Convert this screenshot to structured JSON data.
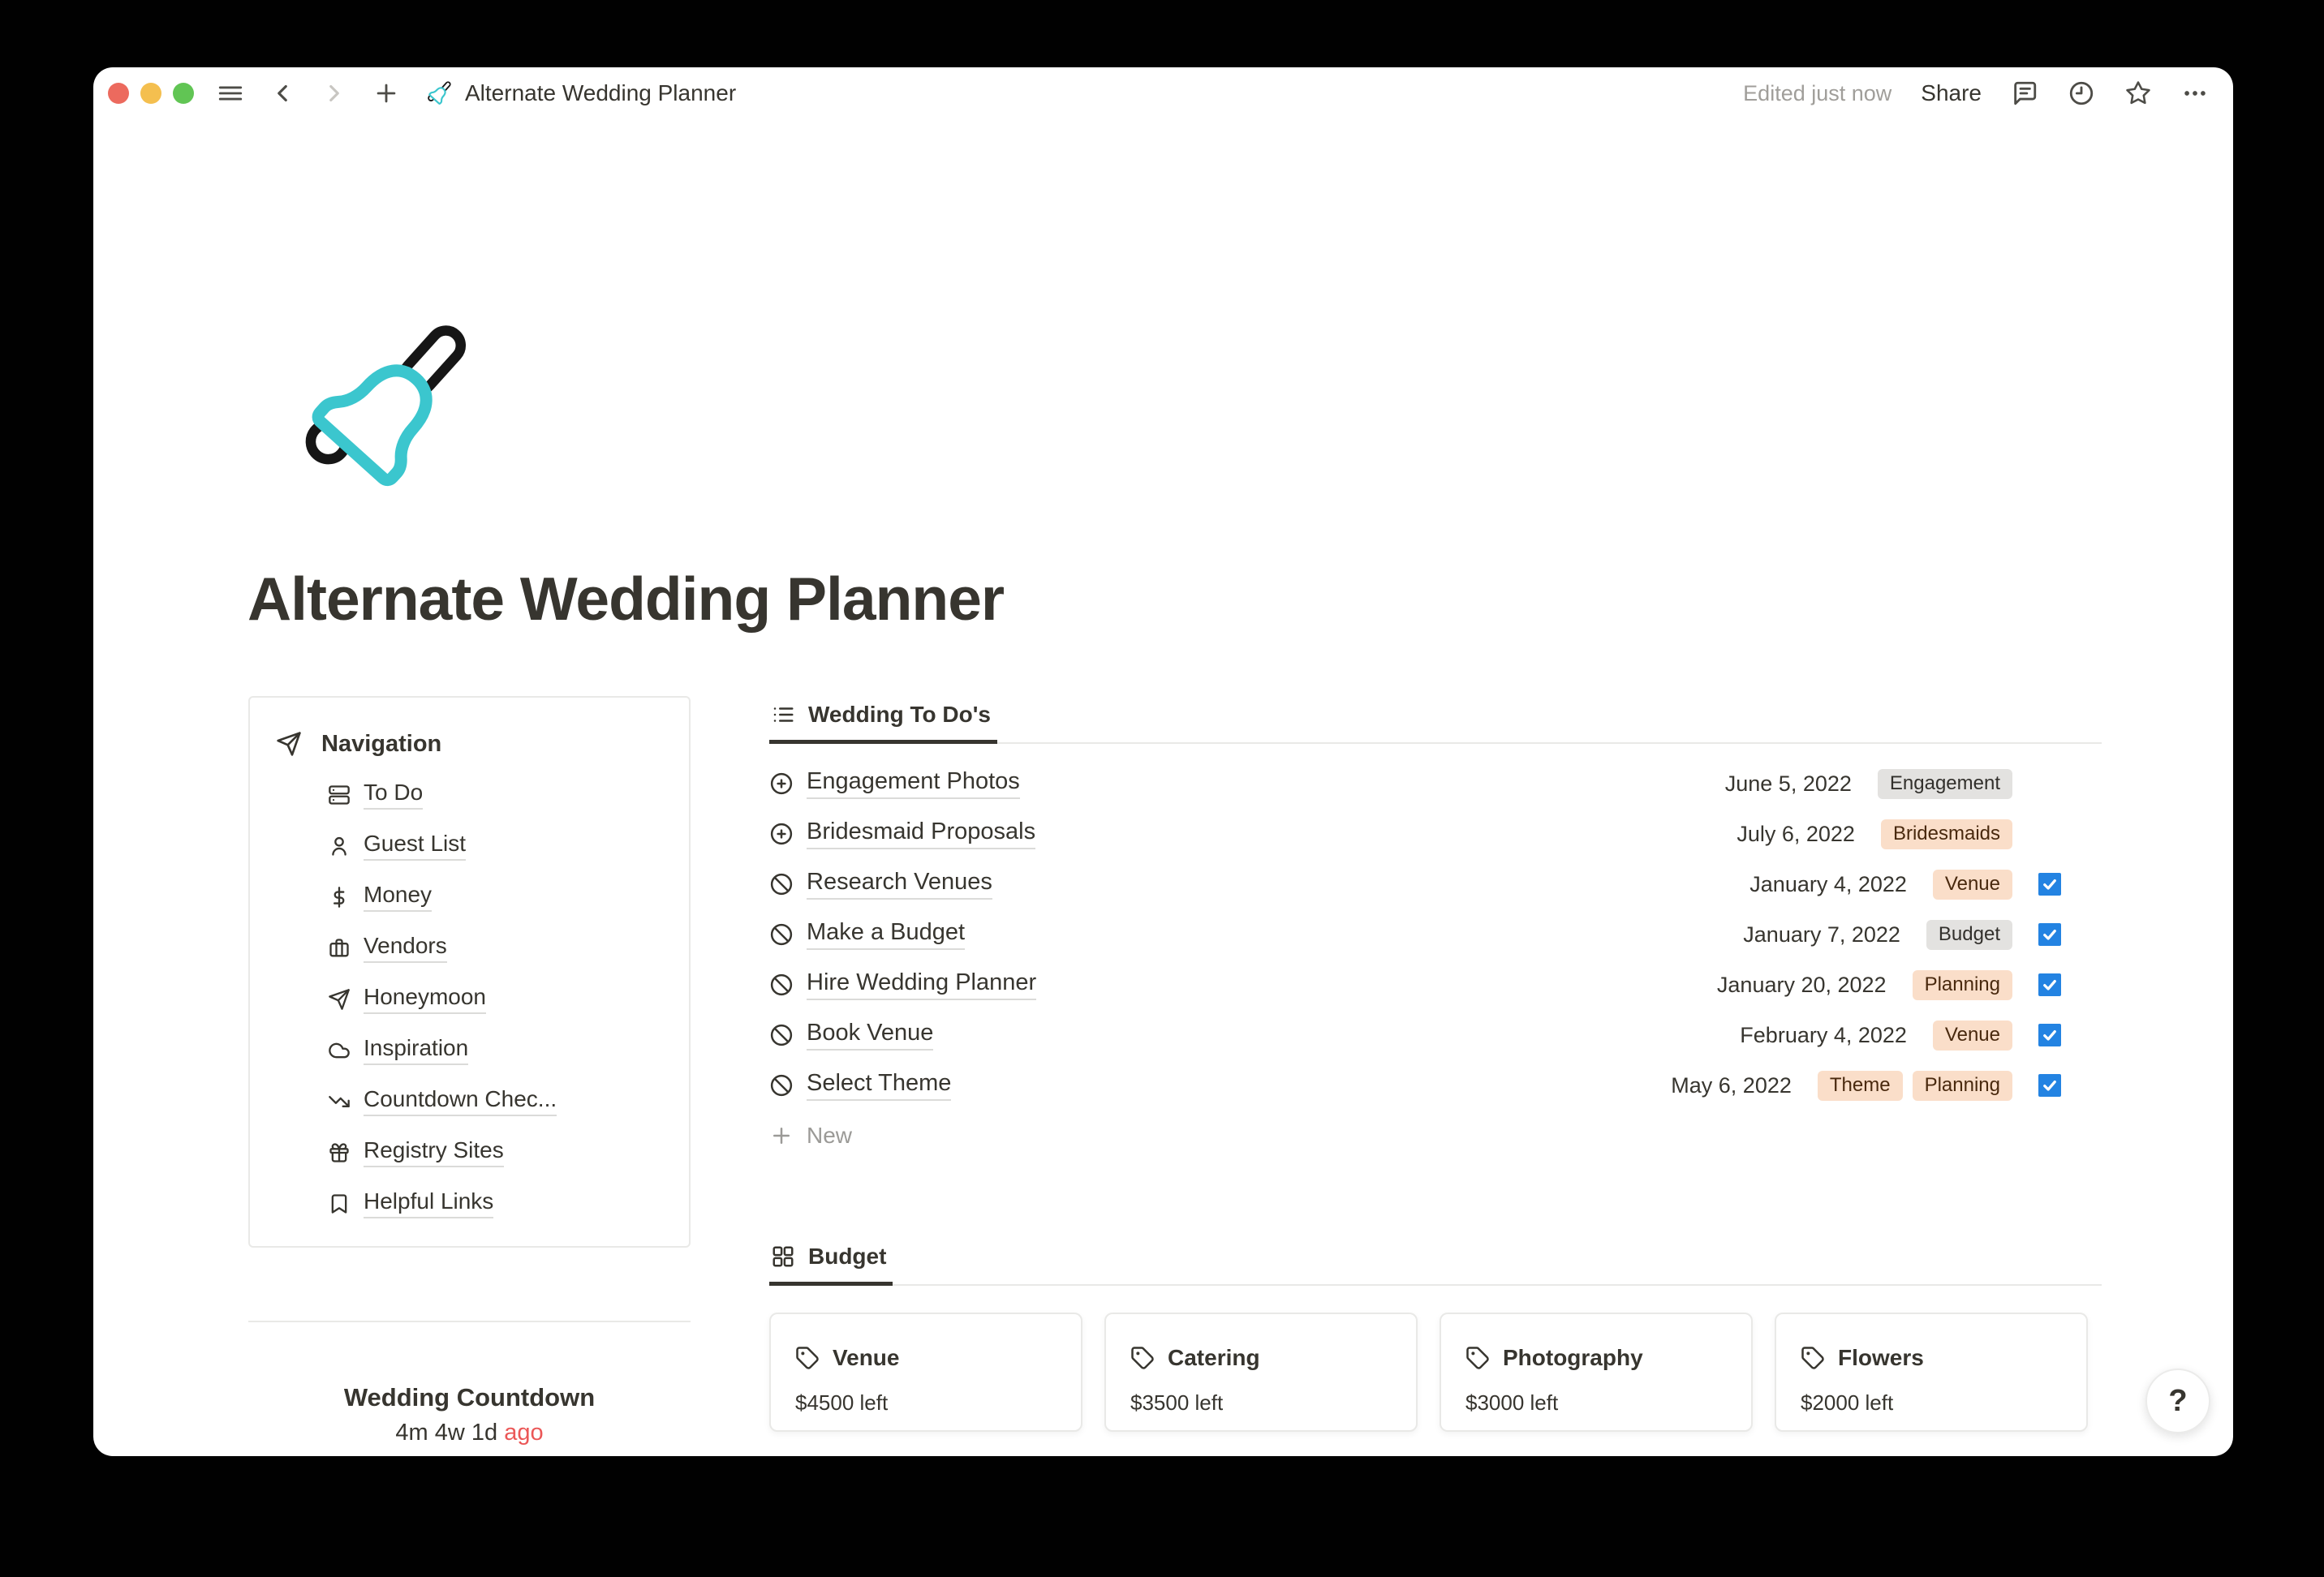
{
  "toolbar": {
    "doc_title": "Alternate Wedding Planner",
    "edited": "Edited just now",
    "share_label": "Share",
    "icons": [
      "menu-icon",
      "chevron-left-icon",
      "chevron-right-icon",
      "plus-icon",
      "page-bell-icon",
      "comment-icon",
      "history-clock-icon",
      "star-icon",
      "ellipsis-icon"
    ]
  },
  "page": {
    "title": "Alternate Wedding Planner",
    "cover_icon": "handbell-icon"
  },
  "navigation": {
    "header": "Navigation",
    "header_icon": "send-icon",
    "items": [
      {
        "label": "To Do",
        "icon": "server-icon"
      },
      {
        "label": "Guest List",
        "icon": "user-icon"
      },
      {
        "label": "Money",
        "icon": "dollar-icon"
      },
      {
        "label": "Vendors",
        "icon": "briefcase-icon"
      },
      {
        "label": "Honeymoon",
        "icon": "send-icon"
      },
      {
        "label": "Inspiration",
        "icon": "cloud-icon"
      },
      {
        "label": "Countdown Chec...",
        "icon": "trending-down-icon"
      },
      {
        "label": "Registry Sites",
        "icon": "gift-icon"
      },
      {
        "label": "Helpful Links",
        "icon": "bookmark-icon"
      }
    ]
  },
  "todo": {
    "tab_label": "Wedding To Do's",
    "tab_icon": "list-icon",
    "new_label": "New",
    "rows": [
      {
        "title": "Engagement Photos",
        "icon": "circle-plus-icon",
        "date": "June 5, 2022",
        "checked": false,
        "tags": [
          {
            "label": "Engagement",
            "color": "gray"
          }
        ]
      },
      {
        "title": "Bridesmaid Proposals",
        "icon": "circle-plus-icon",
        "date": "July 6, 2022",
        "checked": false,
        "tags": [
          {
            "label": "Bridesmaids",
            "color": "peach"
          }
        ]
      },
      {
        "title": "Research Venues",
        "icon": "ban-icon",
        "date": "January 4, 2022",
        "checked": true,
        "tags": [
          {
            "label": "Venue",
            "color": "peach"
          }
        ]
      },
      {
        "title": "Make a Budget",
        "icon": "ban-icon",
        "date": "January 7, 2022",
        "checked": true,
        "tags": [
          {
            "label": "Budget",
            "color": "gray"
          }
        ]
      },
      {
        "title": "Hire Wedding Planner",
        "icon": "ban-icon",
        "date": "January 20, 2022",
        "checked": true,
        "tags": [
          {
            "label": "Planning",
            "color": "peach"
          }
        ]
      },
      {
        "title": "Book Venue",
        "icon": "ban-icon",
        "date": "February 4, 2022",
        "checked": true,
        "tags": [
          {
            "label": "Venue",
            "color": "peach"
          }
        ]
      },
      {
        "title": "Select Theme",
        "icon": "ban-icon",
        "date": "May 6, 2022",
        "checked": true,
        "tags": [
          {
            "label": "Theme",
            "color": "peach"
          },
          {
            "label": "Planning",
            "color": "peach"
          }
        ]
      }
    ]
  },
  "budget": {
    "tab_label": "Budget",
    "tab_icon": "grid-icon",
    "cards": [
      {
        "title": "Venue",
        "icon": "tag-icon",
        "amount": "$4500 left"
      },
      {
        "title": "Catering",
        "icon": "tag-icon",
        "amount": "$3500 left"
      },
      {
        "title": "Photography",
        "icon": "tag-icon",
        "amount": "$3000 left"
      },
      {
        "title": "Flowers",
        "icon": "tag-icon",
        "amount": "$2000 left"
      }
    ]
  },
  "countdown": {
    "title": "Wedding Countdown",
    "value": "4m 4w 1d",
    "suffix": "ago"
  },
  "help": {
    "label": "?"
  },
  "colors": {
    "text": "#37352F",
    "muted": "#9B9A97",
    "checkbox_blue": "#2383E2",
    "tag_gray_bg": "#E3E2E0",
    "tag_peach_bg": "#FADEC9",
    "tag_peach_text": "#49290E",
    "ago_red": "#EB5757",
    "bell_teal": "#3BC6CE",
    "border": "#E9E9E7"
  }
}
